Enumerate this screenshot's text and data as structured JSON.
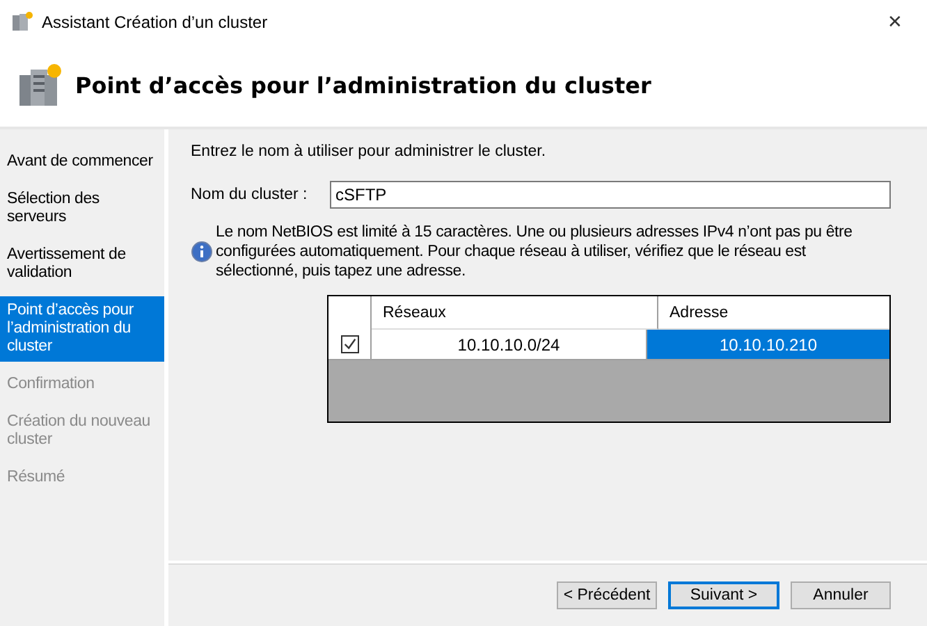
{
  "window": {
    "title": "Assistant Création d’un cluster",
    "close": "✕"
  },
  "header": {
    "title": "Point d’accès pour l’administration du cluster"
  },
  "sidebar": {
    "items": [
      {
        "label": "Avant de commencer",
        "selected": false,
        "disabled": false
      },
      {
        "label": "Sélection des serveurs",
        "selected": false,
        "disabled": false
      },
      {
        "label": "Avertissement de validation",
        "selected": false,
        "disabled": false
      },
      {
        "label": "Point d’accès pour l’administration du cluster",
        "selected": true,
        "disabled": false
      },
      {
        "label": "Confirmation",
        "selected": false,
        "disabled": true
      },
      {
        "label": "Création du nouveau cluster",
        "selected": false,
        "disabled": true
      },
      {
        "label": "Résumé",
        "selected": false,
        "disabled": true
      }
    ]
  },
  "content": {
    "instruction": "Entrez le nom à utiliser pour administrer le cluster.",
    "name_label": "Nom du cluster :",
    "name_value": "cSFTP",
    "info": "Le nom NetBIOS est limité à 15 caractères.  Une ou plusieurs adresses IPv4 n’ont pas pu être configurées automatiquement. Pour chaque réseau à utiliser, vérifiez que le réseau est sélectionné, puis tapez une adresse.",
    "table": {
      "columns": [
        "Réseaux",
        "Adresse"
      ],
      "rows": [
        {
          "checked": true,
          "network": "10.10.10.0/24",
          "address": "10.10.10.210",
          "selected": true
        }
      ]
    }
  },
  "buttons": [
    {
      "label": "< Précédent",
      "default": false
    },
    {
      "label": "Suivant >",
      "default": true
    },
    {
      "label": "Annuler",
      "default": false
    }
  ]
}
